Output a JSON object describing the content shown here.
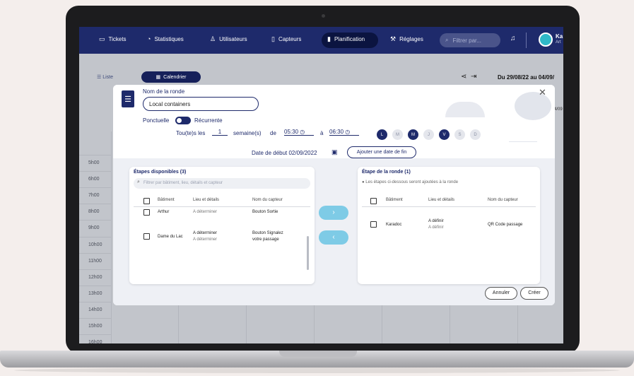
{
  "nav": {
    "items": [
      {
        "label": "Tickets",
        "icon": "ticket-icon"
      },
      {
        "label": "Statistiques",
        "icon": "gauge-icon"
      },
      {
        "label": "Utilisateurs",
        "icon": "user-icon"
      },
      {
        "label": "Capteurs",
        "icon": "device-icon"
      },
      {
        "label": "Planification",
        "icon": "clipboard-icon"
      },
      {
        "label": "Réglages",
        "icon": "wrench-icon"
      }
    ],
    "search_placeholder": "Filtrer par...",
    "user_line1": "Ka",
    "user_line2": "Art",
    "colors": {
      "nav_bg": "#1e2a6b",
      "active_bg": "#0b1440"
    }
  },
  "toolbar": {
    "liste_label": "Liste",
    "calendar_label": "Calendrier",
    "date_range": "Du 29/08/22 au 04/09/",
    "week_label_partial": "4/09"
  },
  "times": [
    "5h00",
    "6h00",
    "7h00",
    "8h00",
    "9h00",
    "10h00",
    "11h00",
    "12h00",
    "13h00",
    "14h00",
    "15h00",
    "16h00",
    "17h00"
  ],
  "modal": {
    "name_label": "Nom de la ronde",
    "name_value": "Local containers",
    "mode_left": "Ponctuelle",
    "mode_right": "Récurrente",
    "recurrence": {
      "prefix": "Tou(te)s les",
      "every": "1",
      "unit": "semaine(s)",
      "de": "de",
      "from": "05:30",
      "a": "à",
      "to": "06:30"
    },
    "days": [
      {
        "label": "L",
        "active": true
      },
      {
        "label": "M",
        "active": false
      },
      {
        "label": "M",
        "active": true
      },
      {
        "label": "J",
        "active": false
      },
      {
        "label": "V",
        "active": true
      },
      {
        "label": "S",
        "active": false
      },
      {
        "label": "D",
        "active": false
      }
    ],
    "start_date": "Date de début 02/09/2022",
    "add_end_date": "Ajouter une date de fin",
    "available": {
      "title": "Étapes disponibles (3)",
      "search_placeholder": "Filtrer par bâtiment, lieu, détails et capteur",
      "headers": [
        "Bâtiment",
        "Lieu et détails",
        "Nom du capteur"
      ],
      "rows": [
        {
          "building": "Arthur",
          "place": "A déterminer",
          "detail": "A déterminer",
          "sensor": "Bouton Sortie",
          "sensor2": ""
        },
        {
          "building": "Dame du Lac",
          "place": "A déterminer",
          "detail": "A déterminer",
          "sensor": "Bouton Signalez",
          "sensor2": "votre passage"
        }
      ]
    },
    "selected": {
      "title": "Étape de la ronde (1)",
      "info": "Les étapes ci-dessous seront ajoutées à la ronde",
      "headers": [
        "Bâtiment",
        "Lieu et détails",
        "Nom du capteur"
      ],
      "rows": [
        {
          "building": "Karadoc",
          "place": "A définir",
          "detail": "A définir",
          "sensor": "QR Code passage"
        }
      ]
    },
    "cancel": "Annuler",
    "create": "Créer"
  }
}
